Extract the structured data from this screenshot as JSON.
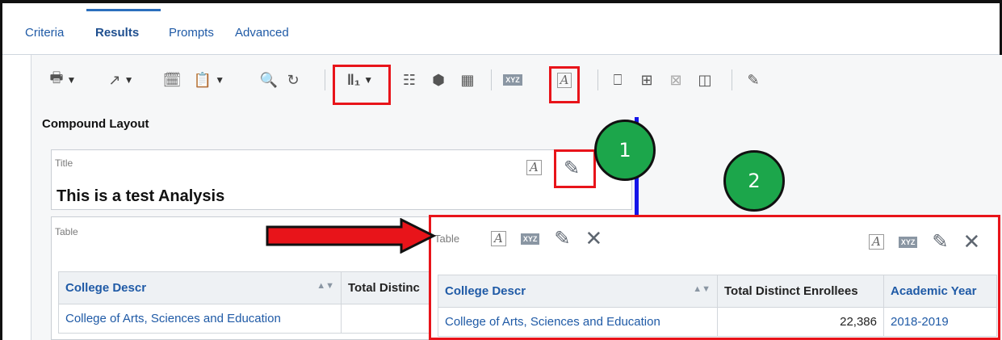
{
  "tabs": [
    {
      "label": "Criteria"
    },
    {
      "label": "Results"
    },
    {
      "label": "Prompts"
    },
    {
      "label": "Advanced"
    }
  ],
  "toolbar": {
    "icons": [
      "print-icon",
      "export-icon",
      "add-view-icon",
      "copy-view-icon",
      "print-preview-icon",
      "refresh-icon",
      "new-graph-icon",
      "new-table-icon",
      "new-pivot-icon",
      "new-view-icon",
      "narrative-icon",
      "title-icon",
      "add-row-icon",
      "show-hide-icon",
      "remove-icon",
      "compound-icon",
      "edit-icon"
    ],
    "xyz_label": "XYZ"
  },
  "compound_layout_label": "Compound Layout",
  "title_view": {
    "label": "Title",
    "title": "This is a test Analysis"
  },
  "table_view_left": {
    "label": "Table",
    "headers": [
      "College Descr",
      "Total Distinc"
    ],
    "rows": [
      [
        "College of Arts, Sciences and Education",
        ""
      ]
    ]
  },
  "table_view_right": {
    "label": "Table",
    "headers": [
      "College Descr",
      "Total Distinct Enrollees",
      "Academic Year"
    ],
    "rows": [
      [
        "College of Arts, Sciences and Education",
        "22,386",
        "2018-2019"
      ]
    ]
  },
  "callouts": {
    "one": "1",
    "two": "2"
  },
  "colors": {
    "highlight_red": "#e8141a",
    "callout_green": "#1ca64b",
    "guide_blue": "#1414e8",
    "link_blue": "#1f5aa6"
  }
}
